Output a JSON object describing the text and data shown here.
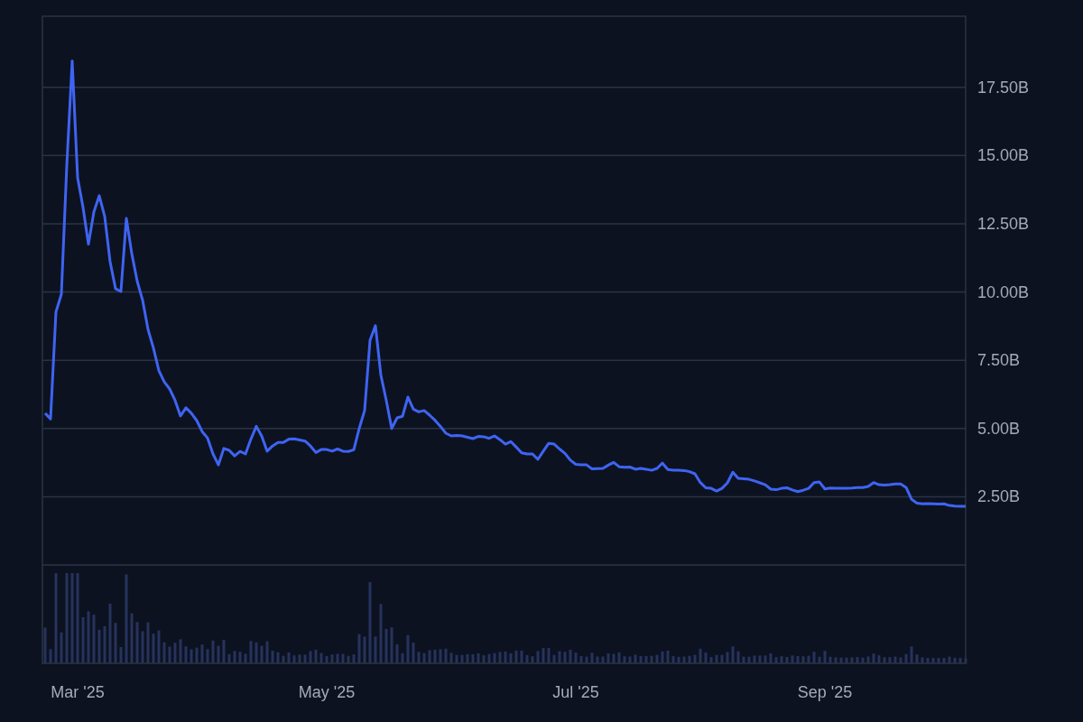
{
  "chart": {
    "chart_data": {
      "type": "line",
      "categories": [
        null,
        null,
        null,
        null,
        null,
        null,
        "Mar '25",
        null,
        null,
        null,
        null,
        null,
        null,
        null,
        null,
        null,
        null,
        null,
        null,
        null,
        null,
        null,
        null,
        null,
        null,
        null,
        null,
        null,
        null,
        null,
        null,
        null,
        null,
        null,
        null,
        null,
        null,
        null,
        null,
        null,
        null,
        null,
        null,
        null,
        null,
        null,
        null,
        null,
        null,
        null,
        null,
        null,
        "May '25",
        null,
        null,
        null,
        null,
        null,
        null,
        null,
        null,
        null,
        null,
        null,
        null,
        null,
        null,
        null,
        null,
        null,
        null,
        null,
        null,
        null,
        null,
        null,
        null,
        null,
        null,
        null,
        null,
        null,
        null,
        null,
        null,
        null,
        null,
        null,
        null,
        null,
        null,
        null,
        null,
        null,
        null,
        null,
        null,
        null,
        "Jul '25",
        null,
        null,
        null,
        null,
        null,
        null,
        null,
        null,
        null,
        null,
        null,
        null,
        null,
        null,
        null,
        null,
        null,
        null,
        null,
        null,
        null,
        null,
        null,
        null,
        null,
        null,
        null,
        null,
        null,
        null,
        null,
        null,
        null,
        null,
        null,
        null,
        null,
        null,
        null,
        null,
        null,
        null,
        null,
        null,
        null,
        "Sep '25",
        null,
        null,
        null,
        null,
        null,
        null,
        null,
        null,
        null,
        null,
        null,
        null,
        null,
        null,
        null,
        null,
        null,
        null,
        null,
        null,
        null,
        null,
        null,
        null,
        null,
        null
      ],
      "series": [
        {
          "color": "#3f64f2",
          "values": [
            5.56,
            5.35,
            9.27,
            9.92,
            14.64,
            18.46,
            14.18,
            13.1,
            11.75,
            12.93,
            13.53,
            12.77,
            11.11,
            10.12,
            10.02,
            12.7,
            11.41,
            10.4,
            9.7,
            8.63,
            7.95,
            7.12,
            6.71,
            6.45,
            6.03,
            5.46,
            5.76,
            5.56,
            5.29,
            4.89,
            4.65,
            4.07,
            3.67,
            4.27,
            4.2,
            4.0,
            4.16,
            4.07,
            4.61,
            5.08,
            4.72,
            4.17,
            4.36,
            4.49,
            4.49,
            4.61,
            4.62,
            4.58,
            4.54,
            4.36,
            4.12,
            4.23,
            4.23,
            4.17,
            4.25,
            4.17,
            4.16,
            4.22,
            5.0,
            5.66,
            8.23,
            8.77,
            6.96,
            6.03,
            5.0,
            5.39,
            5.45,
            6.15,
            5.71,
            5.61,
            5.66,
            5.49,
            5.3,
            5.08,
            4.83,
            4.73,
            4.75,
            4.73,
            4.68,
            4.63,
            4.71,
            4.7,
            4.64,
            4.73,
            4.59,
            4.43,
            4.52,
            4.32,
            4.11,
            4.07,
            4.07,
            3.87,
            4.17,
            4.46,
            4.43,
            4.25,
            4.09,
            3.84,
            3.69,
            3.67,
            3.67,
            3.52,
            3.53,
            3.54,
            3.66,
            3.76,
            3.6,
            3.58,
            3.59,
            3.51,
            3.54,
            3.51,
            3.47,
            3.54,
            3.73,
            3.5,
            3.47,
            3.47,
            3.46,
            3.42,
            3.34,
            3.02,
            2.83,
            2.81,
            2.71,
            2.81,
            3.01,
            3.4,
            3.18,
            3.16,
            3.14,
            3.08,
            3.01,
            2.94,
            2.78,
            2.76,
            2.81,
            2.83,
            2.75,
            2.69,
            2.74,
            2.81,
            3.02,
            3.04,
            2.79,
            2.82,
            2.81,
            2.81,
            2.81,
            2.82,
            2.84,
            2.84,
            2.88,
            3.02,
            2.94,
            2.93,
            2.94,
            2.97,
            2.97,
            2.84,
            2.41,
            2.27,
            2.24,
            2.25,
            2.24,
            2.23,
            2.24,
            2.18,
            2.16,
            2.15,
            2.15
          ]
        }
      ],
      "ylim": [
        -3.6,
        20.1
      ],
      "grid": true,
      "yticks": [
        {
          "value": 2.5,
          "label": "2.50B"
        },
        {
          "value": 5,
          "label": "5.00B"
        },
        {
          "value": 7.5,
          "label": "7.50B"
        },
        {
          "value": 10,
          "label": "10.00B"
        },
        {
          "value": 12.5,
          "label": "12.50B"
        },
        {
          "value": 15,
          "label": "15.00B"
        },
        {
          "value": 17.5,
          "label": "17.50B"
        }
      ]
    }
  }
}
